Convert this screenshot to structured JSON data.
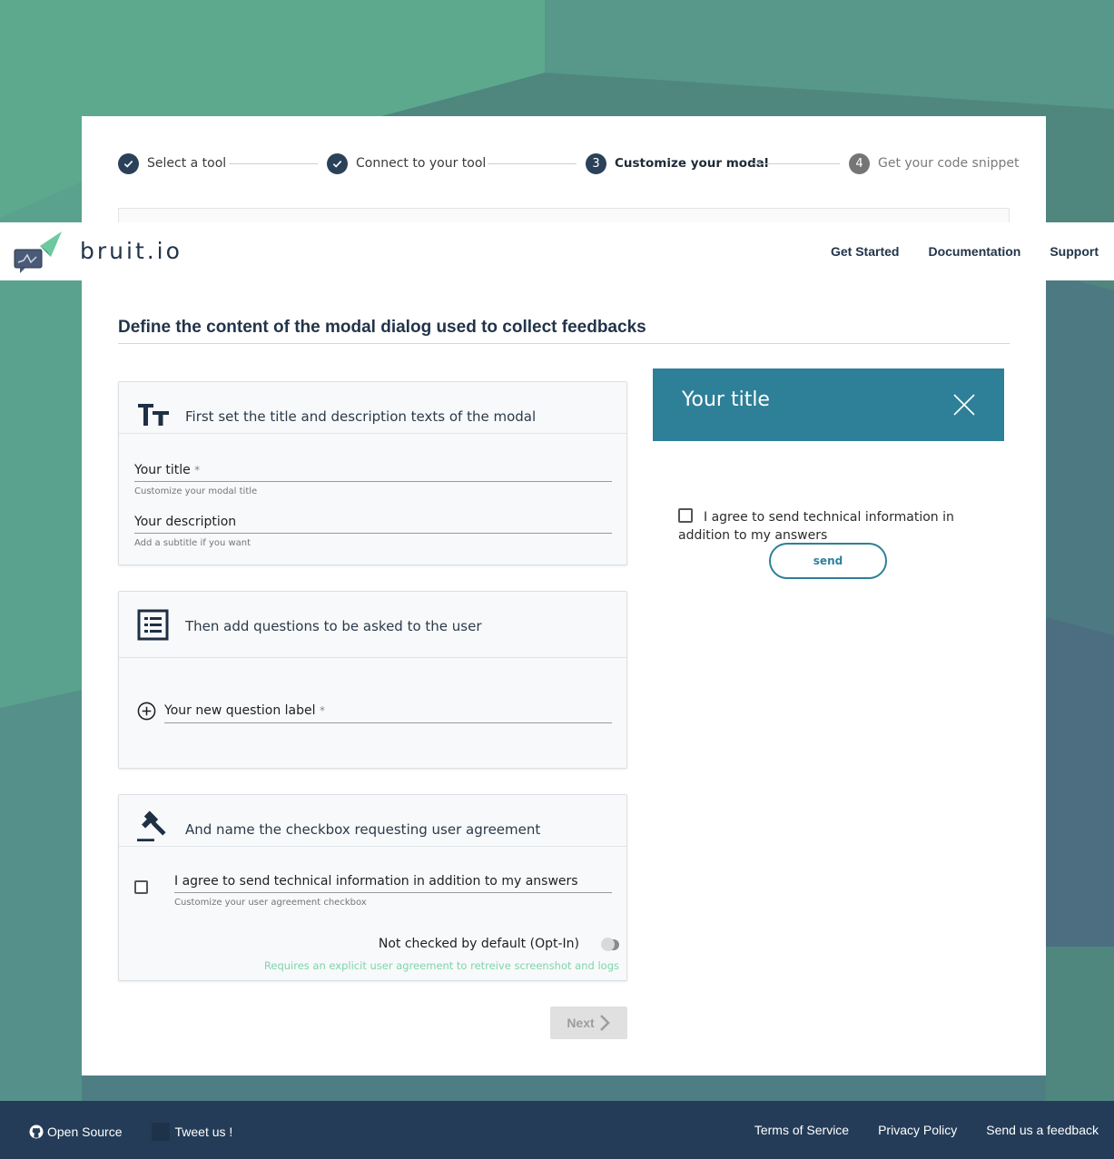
{
  "colors": {
    "accent": "#2e8098",
    "navy": "#243c58",
    "mint_note": "#7fd4ae"
  },
  "header": {
    "brand": "bruit.io",
    "nav": [
      "Get Started",
      "Documentation",
      "Support"
    ]
  },
  "stepper": {
    "steps": [
      {
        "label": "Select a tool",
        "state": "done",
        "number": "1"
      },
      {
        "label": "Connect to your tool",
        "state": "done",
        "number": "2"
      },
      {
        "label": "Customize your modal",
        "state": "active",
        "number": "3"
      },
      {
        "label": "Get your code snippet",
        "state": "pending",
        "number": "4"
      }
    ]
  },
  "main": {
    "section_title": "Define the content of the modal dialog used to collect feedbacks",
    "title_panel": {
      "icon": "text-size-icon",
      "heading": "First set the title and description texts of the modal",
      "title_field": {
        "label": "Your title",
        "required_mark": "*",
        "hint": "Customize your modal title"
      },
      "description_field": {
        "label": "Your description",
        "hint": "Add a subtitle if you want"
      }
    },
    "questions_panel": {
      "icon": "list-icon",
      "heading": "Then add questions to be asked to the user",
      "new_question": {
        "label": "Your new question label",
        "required_mark": "*"
      }
    },
    "agreement_panel": {
      "icon": "gavel-icon",
      "heading": "And name the checkbox requesting user agreement",
      "checkbox_label": "I agree to send technical information in addition to my answers",
      "checkbox_hint": "Customize your user agreement checkbox",
      "toggle_label": "Not checked by default (Opt-In)",
      "toggle_on": false,
      "requirement_note": "Requires an explicit user agreement to retreive screenshot and logs"
    },
    "next_label": "Next"
  },
  "preview": {
    "title": "Your title",
    "agree_text": "I agree to send technical information in addition to my answers",
    "send_label": "send"
  },
  "footer": {
    "left": [
      "Open Source",
      "Tweet us !"
    ],
    "right": [
      "Terms of Service",
      "Privacy Policy",
      "Send us a feedback"
    ]
  }
}
